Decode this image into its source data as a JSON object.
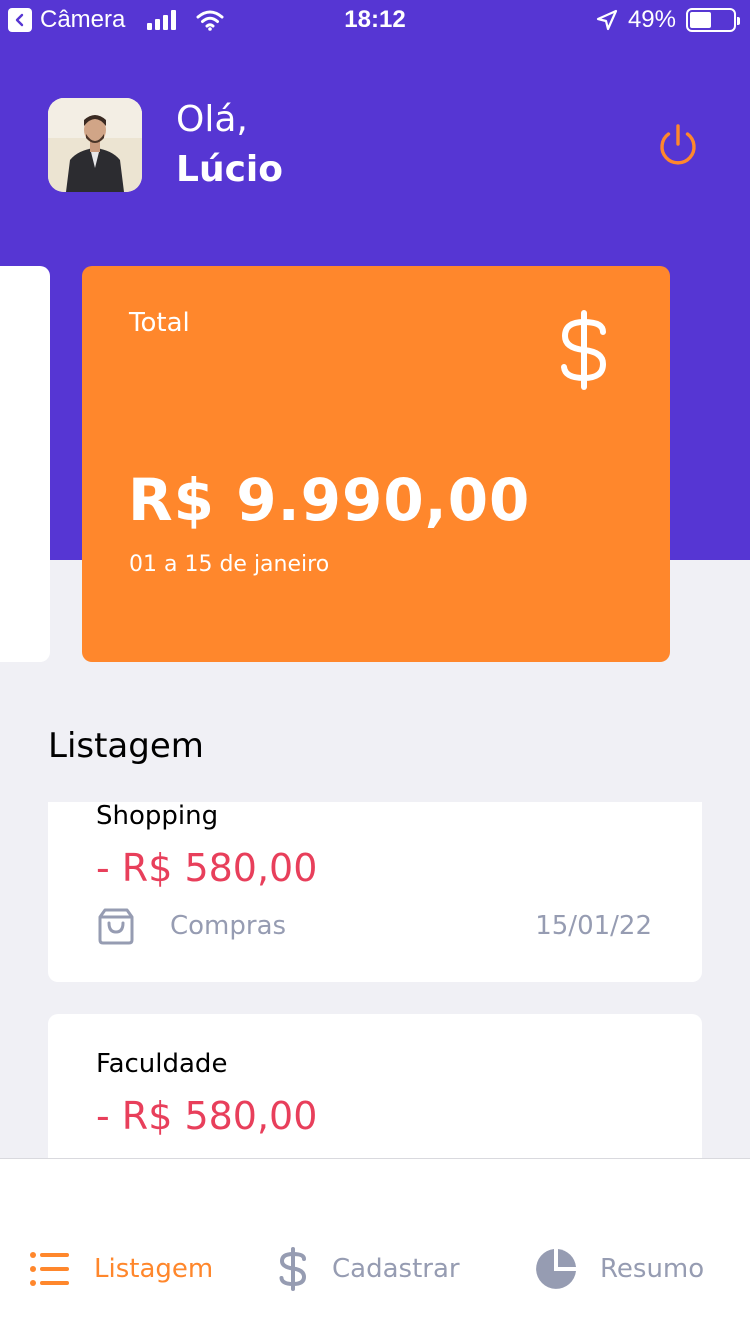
{
  "status_bar": {
    "back_label": "Câmera",
    "time": "18:12",
    "battery": "49%",
    "battery_level": 0.49
  },
  "header": {
    "greeting": "Olá,",
    "user_name": "Lúcio",
    "avatar_icon": "user-photo",
    "logout_icon": "power-icon"
  },
  "highlight_card": {
    "title": "Total",
    "amount": "R$ 9.990,00",
    "period": "01 a 15 de janeiro",
    "icon": "dollar-sign-icon"
  },
  "listing": {
    "title": "Listagem",
    "transactions": [
      {
        "title": "Shopping",
        "amount": "- R$ 580,00",
        "category": "Compras",
        "category_icon": "shopping-bag-icon",
        "date": "15/01/22"
      },
      {
        "title": "Faculdade",
        "amount": "- R$ 580,00",
        "category": "",
        "date": ""
      }
    ]
  },
  "tabbar": {
    "items": [
      {
        "label": "Listagem",
        "icon": "list-icon",
        "active": true
      },
      {
        "label": "Cadastrar",
        "icon": "dollar-sign-icon",
        "active": false
      },
      {
        "label": "Resumo",
        "icon": "pie-chart-icon",
        "active": false
      }
    ]
  },
  "colors": {
    "primary": "#5636D3",
    "secondary": "#FF872C",
    "attention": "#E83F5B",
    "text_muted": "#969CB2",
    "background": "#F0F0F5"
  }
}
